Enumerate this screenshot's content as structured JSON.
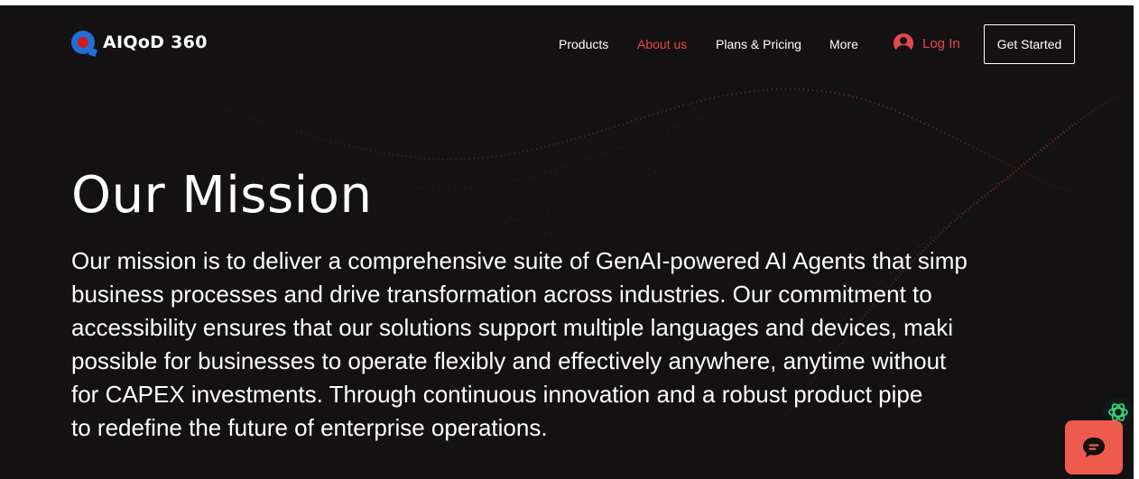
{
  "brand": {
    "name": "AIQoD 360"
  },
  "nav": {
    "items": [
      {
        "label": "Products",
        "active": false
      },
      {
        "label": "About us",
        "active": true
      },
      {
        "label": "Plans & Pricing",
        "active": false
      },
      {
        "label": "More",
        "active": false
      }
    ],
    "login_label": "Log In",
    "cta_label": "Get Started"
  },
  "hero": {
    "title": "Our Mission",
    "lines": [
      "Our mission is to deliver a comprehensive suite of GenAI-powered AI Agents that simp",
      "business processes and drive transformation across industries. Our commitment to",
      "accessibility ensures that our solutions support multiple languages and devices, maki",
      "possible for businesses to operate flexibly and effectively anywhere, anytime without",
      "for CAPEX investments. Through continuous innovation and a robust product pipe",
      "to redefine the future of enterprise operations."
    ]
  },
  "icons": {
    "brand": "logo-icon",
    "login": "user-avatar-icon",
    "assistant": "ai-assistant-icon",
    "chat": "chat-bubble-icon"
  },
  "colors": {
    "background": "#141112",
    "accent": "#e5484d",
    "text": "#ffffff",
    "chat_button": "#ee5a4e"
  }
}
